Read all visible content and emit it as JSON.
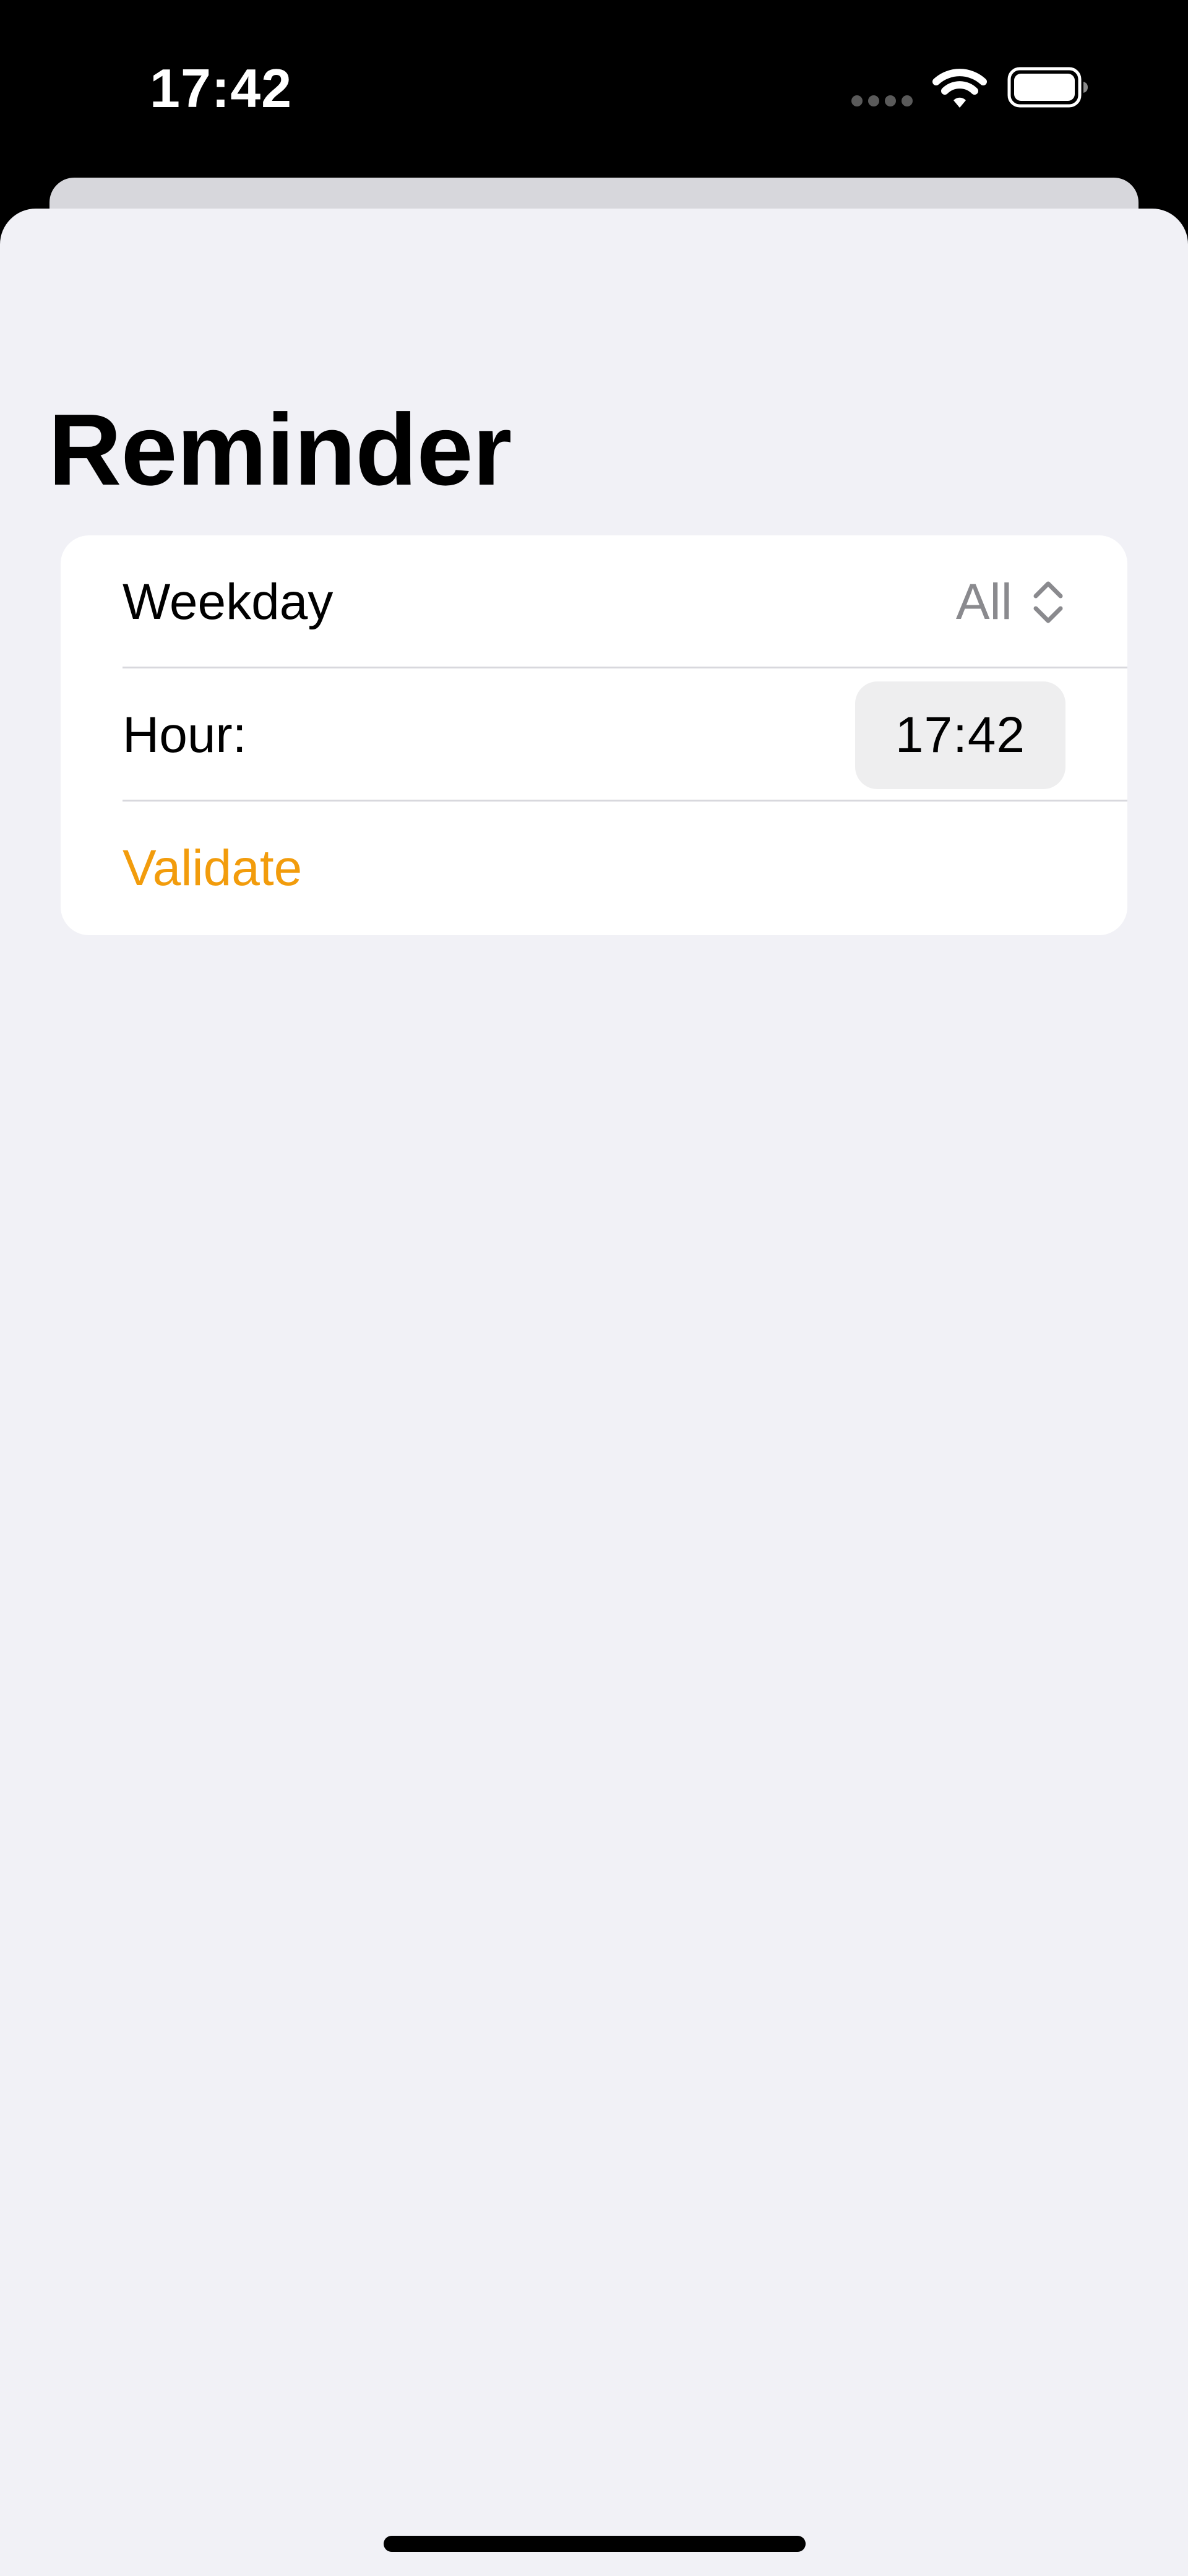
{
  "status_bar": {
    "time": "17:42",
    "icons": [
      "cellular-dots-icon",
      "wifi-icon",
      "battery-icon"
    ]
  },
  "page": {
    "title": "Reminder"
  },
  "form": {
    "weekday": {
      "label": "Weekday",
      "value": "All",
      "icon": "chevron-up-down-icon"
    },
    "hour": {
      "label": "Hour:",
      "value": "17:42"
    },
    "validate_label": "Validate"
  },
  "colors": {
    "accent": "#f29c0c",
    "background": "#f1f1f6",
    "card": "#ffffff",
    "secondary_text": "#8a8a8e",
    "status_bar": "#000000"
  }
}
